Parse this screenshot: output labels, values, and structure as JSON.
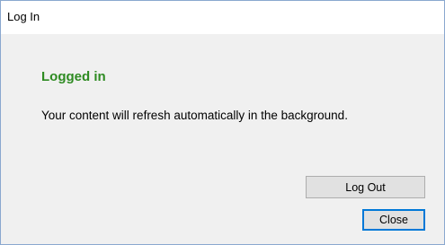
{
  "window": {
    "title": "Log In"
  },
  "content": {
    "heading": "Logged in",
    "heading_color": "#2e8b22",
    "message": "Your content will refresh automatically in the background."
  },
  "buttons": {
    "logout_label": "Log Out",
    "close_label": "Close"
  }
}
